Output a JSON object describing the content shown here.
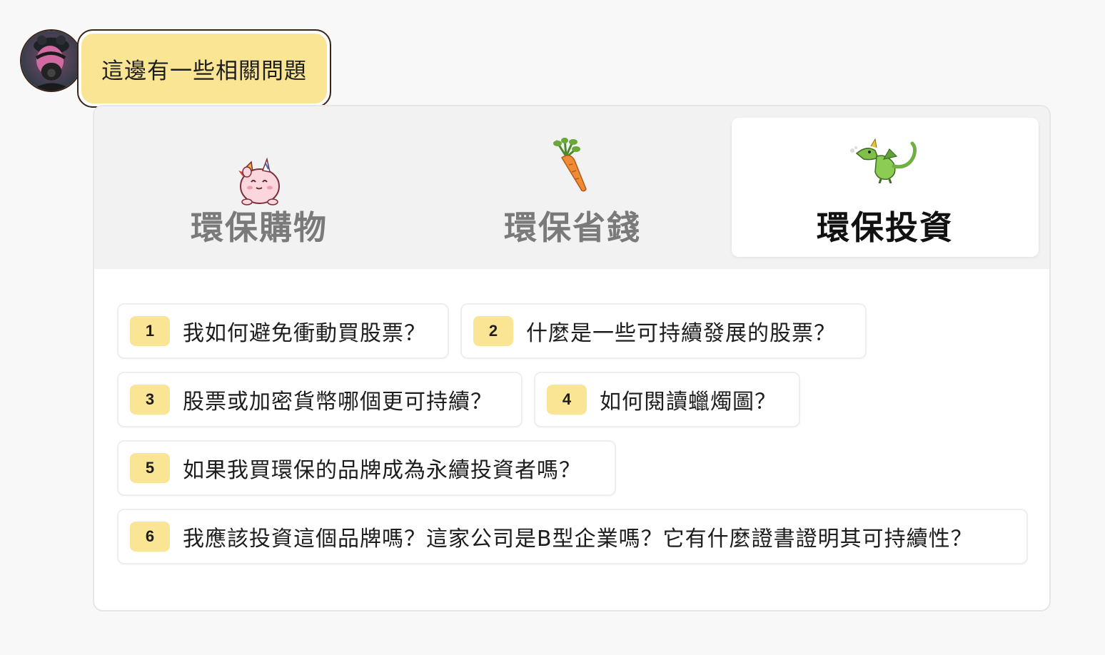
{
  "message": {
    "text": "這邊有一些相關問題"
  },
  "tabs": [
    {
      "label": "環保購物",
      "icon": "pink-unicorn-pig-icon",
      "active": false
    },
    {
      "label": "環保省錢",
      "icon": "carrot-icon",
      "active": false
    },
    {
      "label": "環保投資",
      "icon": "green-dragon-icon",
      "active": true
    }
  ],
  "questions": [
    {
      "num": "1",
      "text": "我如何避免衝動買股票？"
    },
    {
      "num": "2",
      "text": "什麼是一些可持續發展的股票？"
    },
    {
      "num": "3",
      "text": "股票或加密貨幣哪個更可持續？"
    },
    {
      "num": "4",
      "text": "如何閱讀蠟燭圖？"
    },
    {
      "num": "5",
      "text": "如果我買環保的品牌成為永續投資者嗎？"
    },
    {
      "num": "6",
      "text": "我應該投資這個品牌嗎？這家公司是B型企業嗎？它有什麼證書證明其可持續性？"
    }
  ],
  "colors": {
    "accent": "#fae594",
    "border_dark": "#3a2418",
    "tab_bar": "#f2f2f2",
    "inactive_tab_text": "#7a7a7a"
  }
}
